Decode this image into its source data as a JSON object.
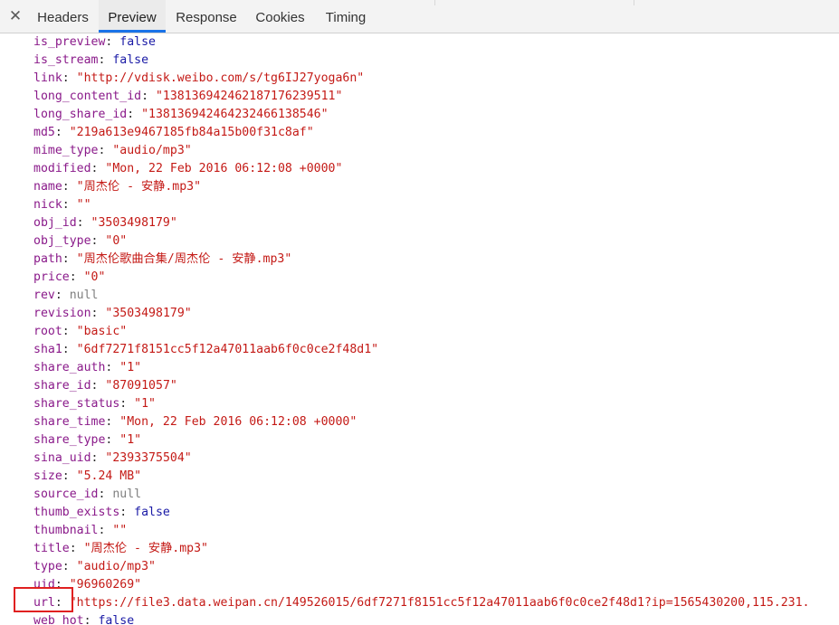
{
  "tabs": {
    "close_symbol": "✕",
    "items": [
      {
        "label": "Headers",
        "active": false
      },
      {
        "label": "Preview",
        "active": true
      },
      {
        "label": "Response",
        "active": false
      },
      {
        "label": "Cookies",
        "active": false
      },
      {
        "label": "Timing",
        "active": false
      }
    ]
  },
  "properties": [
    {
      "key": "is_preview",
      "value": "false",
      "type": "bool"
    },
    {
      "key": "is_stream",
      "value": "false",
      "type": "bool"
    },
    {
      "key": "link",
      "value": "\"http://vdisk.weibo.com/s/tg6IJ27yoga6n\"",
      "type": "str"
    },
    {
      "key": "long_content_id",
      "value": "\"13813694246218717623951 1\"",
      "type": "str"
    },
    {
      "key": "long_share_id",
      "value": "\"138136942464232466138546\"",
      "type": "str"
    },
    {
      "key": "md5",
      "value": "\"219a613e9467185fb84a15b00f31c8af\"",
      "type": "str"
    },
    {
      "key": "mime_type",
      "value": "\"audio/mp3\"",
      "type": "str"
    },
    {
      "key": "modified",
      "value": "\"Mon, 22 Feb 2016 06:12:08 +0000\"",
      "type": "str"
    },
    {
      "key": "name",
      "value": "\"周杰伦 - 安静.mp3\"",
      "type": "str"
    },
    {
      "key": "nick",
      "value": "\"\"",
      "type": "str"
    },
    {
      "key": "obj_id",
      "value": "\"3503498179\"",
      "type": "str"
    },
    {
      "key": "obj_type",
      "value": "\"0\"",
      "type": "str"
    },
    {
      "key": "path",
      "value": "\"周杰伦歌曲合集/周杰伦 - 安静.mp3\"",
      "type": "str"
    },
    {
      "key": "price",
      "value": "\"0\"",
      "type": "str"
    },
    {
      "key": "rev",
      "value": "null",
      "type": "null"
    },
    {
      "key": "revision",
      "value": "\"3503498179\"",
      "type": "str"
    },
    {
      "key": "root",
      "value": "\"basic\"",
      "type": "str"
    },
    {
      "key": "sha1",
      "value": "\"6df7271f8151cc5f12a47011aab6f0c0ce2f48d1\"",
      "type": "str"
    },
    {
      "key": "share_auth",
      "value": "\"1\"",
      "type": "str"
    },
    {
      "key": "share_id",
      "value": "\"87091057\"",
      "type": "str"
    },
    {
      "key": "share_status",
      "value": "\"1\"",
      "type": "str"
    },
    {
      "key": "share_time",
      "value": "\"Mon, 22 Feb 2016 06:12:08 +0000\"",
      "type": "str"
    },
    {
      "key": "share_type",
      "value": "\"1\"",
      "type": "str"
    },
    {
      "key": "sina_uid",
      "value": "\"2393375504\"",
      "type": "str"
    },
    {
      "key": "size",
      "value": "\"5.24 MB\"",
      "type": "str"
    },
    {
      "key": "source_id",
      "value": "null",
      "type": "null"
    },
    {
      "key": "thumb_exists",
      "value": "false",
      "type": "bool"
    },
    {
      "key": "thumbnail",
      "value": "\"\"",
      "type": "str"
    },
    {
      "key": "title",
      "value": "\"周杰伦 - 安静.mp3\"",
      "type": "str"
    },
    {
      "key": "type",
      "value": "\"audio/mp3\"",
      "type": "str"
    },
    {
      "key": "uid",
      "value": "\"96960269\"",
      "type": "str"
    },
    {
      "key": "url",
      "value": "\"https://file3.data.weipan.cn/149526015/6df7271f8151cc5f12a47011aab6f0c0ce2f48d1?ip=1565430200,115.231.",
      "type": "str"
    },
    {
      "key": "web_hot",
      "value": "false",
      "type": "bool"
    }
  ]
}
